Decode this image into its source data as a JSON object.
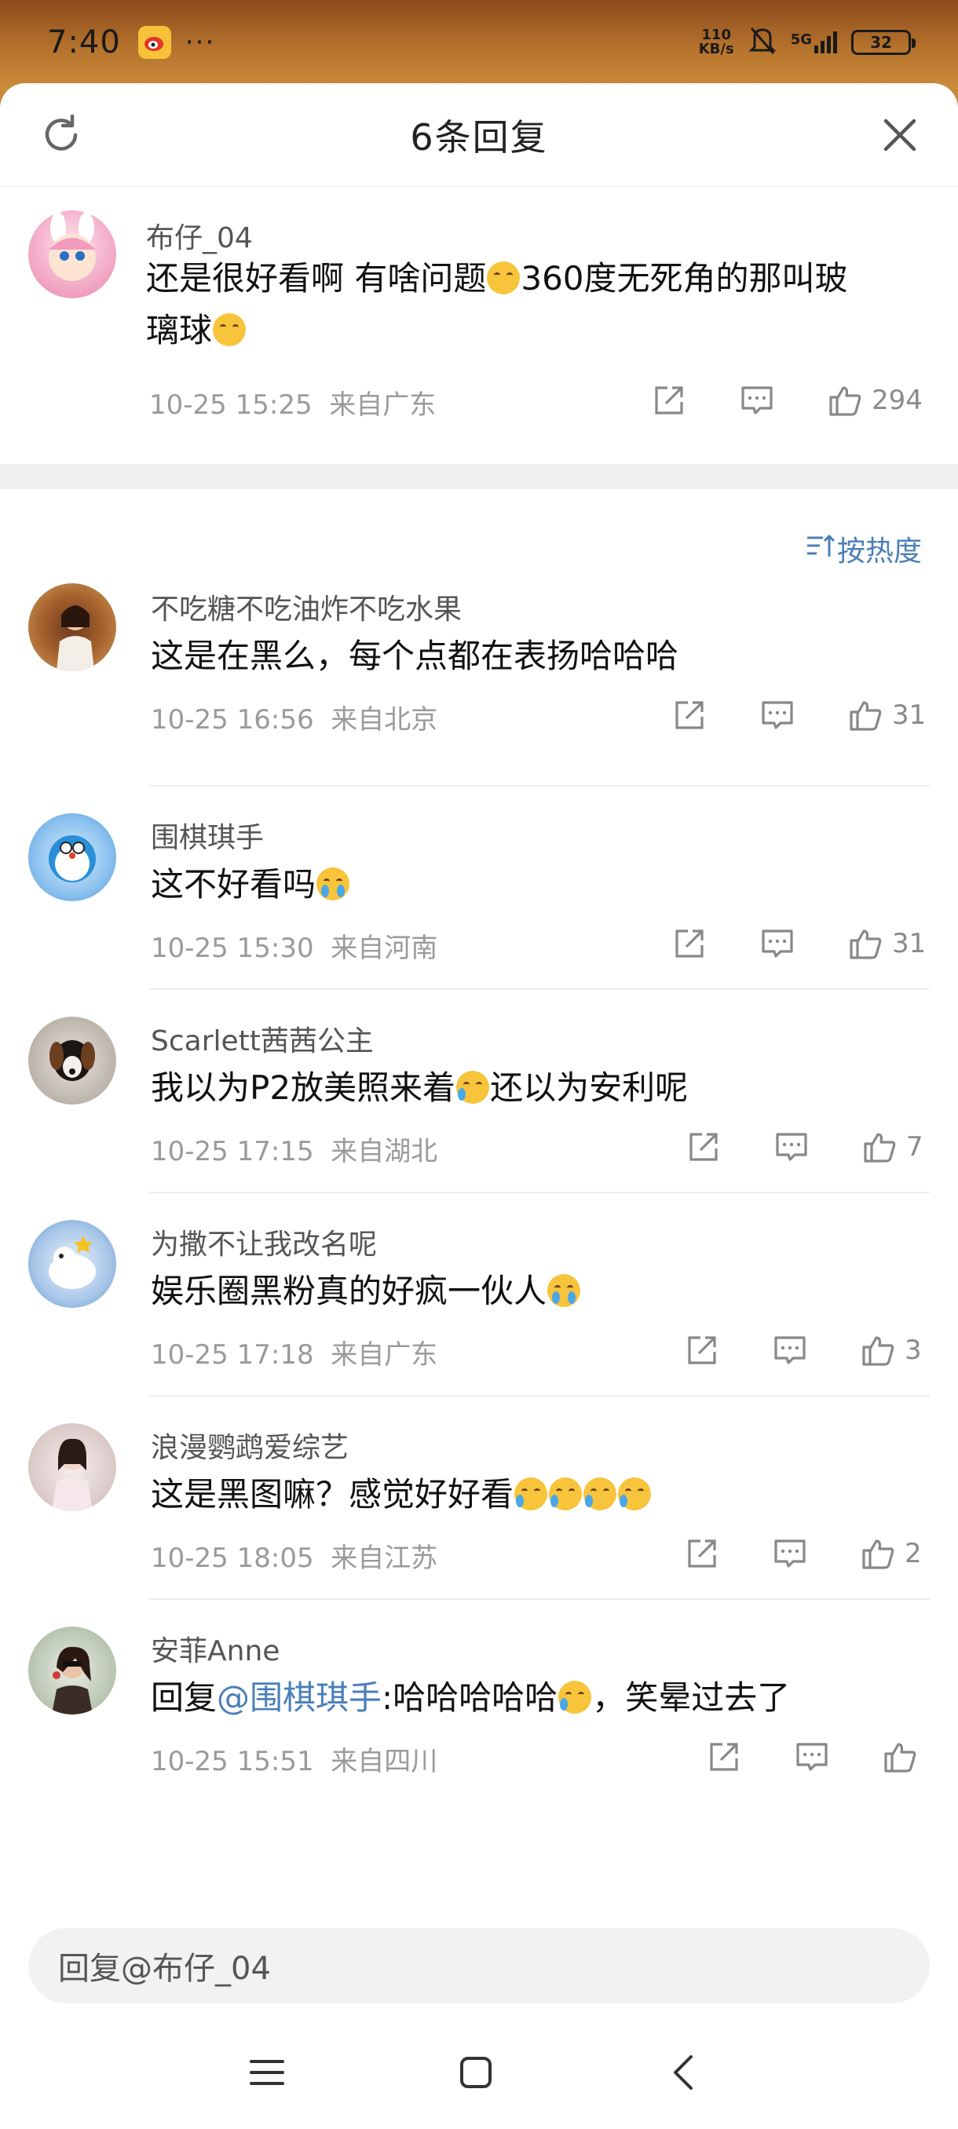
{
  "status": {
    "time": "7:40",
    "more": "···",
    "speed_top": "110",
    "speed_bottom": "KB/s",
    "network": "5G",
    "battery": "32"
  },
  "sheet": {
    "title": "6条回复"
  },
  "main_comment": {
    "username": "布仔_04",
    "text_part1": "还是很好看啊 有啥问题",
    "text_part2": "360度无死角的那叫玻",
    "text_part3": "璃球",
    "date": "10-25 15:25",
    "location": "来自广东",
    "likes": "294"
  },
  "sort": {
    "label": "按热度"
  },
  "comments": [
    {
      "username": "不吃糖不吃油炸不吃水果",
      "text": "这是在黑么，每个点都在表扬哈哈哈",
      "date": "10-25 16:56",
      "location": "来自北京",
      "likes": "31"
    },
    {
      "username": "围棋琪手",
      "text": "这不好看吗",
      "date": "10-25 15:30",
      "location": "来自河南",
      "likes": "31"
    },
    {
      "username": "Scarlett茜茜公主",
      "text_part1": "我以为P2放美照来着",
      "text_part2": "还以为安利呢",
      "date": "10-25 17:15",
      "location": "来自湖北",
      "likes": "7"
    },
    {
      "username": "为撒不让我改名呢",
      "text": "娱乐圈黑粉真的好疯一伙人",
      "date": "10-25 17:18",
      "location": "来自广东",
      "likes": "3"
    },
    {
      "username": "浪漫鹦鹉爱综艺",
      "text": "这是黑图嘛？感觉好好看",
      "date": "10-25 18:05",
      "location": "来自江苏",
      "likes": "2"
    },
    {
      "username": "安菲Anne",
      "reply_prefix": "回复",
      "mention": "@围棋琪手",
      "text_part1": ":哈哈哈哈哈",
      "text_part2": "，笑晕过去了",
      "date": "10-25 15:51",
      "location": "来自四川",
      "likes": ""
    }
  ],
  "reply_bar": {
    "placeholder": "回复@布仔_04"
  },
  "colors": {
    "accent": "#4a7fb8",
    "meta": "#9a9a9a",
    "status_bg": "#b5722c"
  }
}
